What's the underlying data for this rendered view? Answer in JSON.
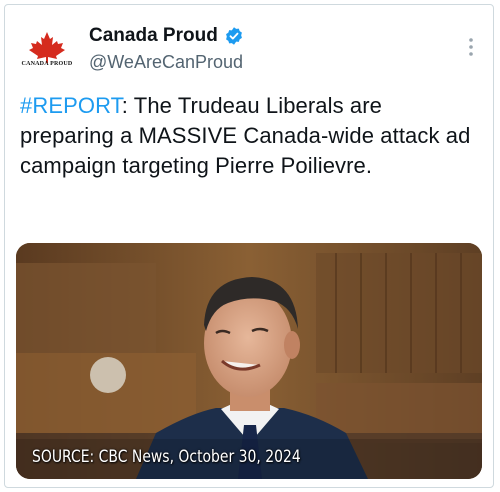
{
  "account": {
    "display_name": "Canada Proud",
    "handle": "@WeAreCanProud",
    "avatar_text": "CANADA PROUD",
    "verified": true
  },
  "tweet": {
    "hashtag": "#REPORT",
    "body": ": The Trudeau Liberals are preparing a MASSIVE Canada-wide attack ad campaign targeting Pierre Poilievre."
  },
  "media": {
    "caption": "SOURCE: CBC News, October 30, 2024"
  },
  "colors": {
    "link": "#1d9bf0",
    "verified_badge": "#1d9bf0",
    "maple_leaf": "#d52b1e",
    "text_primary": "#0f1419",
    "text_secondary": "#536471"
  },
  "icons": {
    "verified": "verified-badge-icon",
    "more": "more-options-icon",
    "avatar": "maple-leaf-icon"
  }
}
